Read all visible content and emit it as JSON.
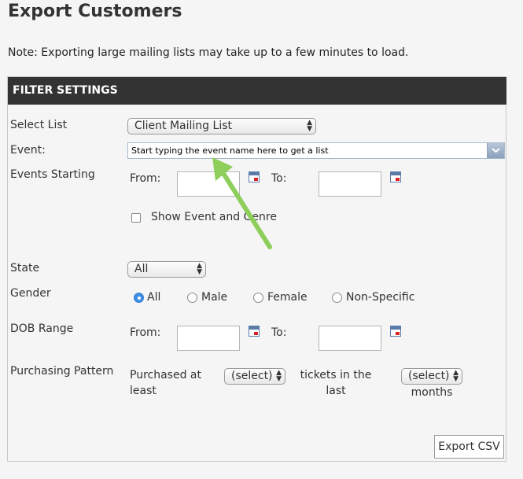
{
  "page": {
    "title": "Export Customers",
    "note": "Note: Exporting large mailing lists may take up to a few minutes to load."
  },
  "filter": {
    "header": "FILTER SETTINGS",
    "select_list": {
      "label": "Select List",
      "value": "Client Mailing List"
    },
    "event": {
      "label": "Event:",
      "value": "Start typing the event name here to get a list"
    },
    "events_starting": {
      "label": "Events Starting",
      "from_label": "From:",
      "to_label": "To:",
      "from_value": "",
      "to_value": ""
    },
    "show_event_genre": {
      "label": "Show Event and Genre",
      "checked": false
    },
    "state": {
      "label": "State",
      "value": "All"
    },
    "gender": {
      "label": "Gender",
      "options": [
        "All",
        "Male",
        "Female",
        "Non-Specific"
      ],
      "selected": "All"
    },
    "dob_range": {
      "label": "DOB Range",
      "from_label": "From:",
      "to_label": "To:",
      "from_value": "",
      "to_value": ""
    },
    "purchasing_pattern": {
      "label": "Purchasing Pattern",
      "purchased_line1": "Purchased at",
      "purchased_line2": "least",
      "tickets_value": "(select)",
      "tickets_line1": "tickets in the",
      "tickets_line2": "last",
      "months_value": "(select)",
      "months_label": "months"
    },
    "export_label": "Export CSV"
  },
  "annotation": {
    "arrow_color": "#8dcf5a"
  },
  "icons": [
    "calendar-icon",
    "select-arrows-icon",
    "dropdown-chevron-icon"
  ]
}
